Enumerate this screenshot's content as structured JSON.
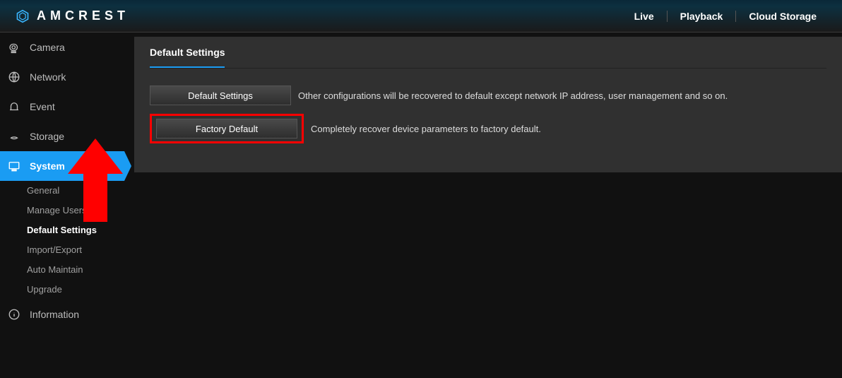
{
  "header": {
    "brand": "AMCREST",
    "nav": {
      "live": "Live",
      "playback": "Playback",
      "cloud": "Cloud Storage"
    }
  },
  "sidebar": {
    "camera": "Camera",
    "network": "Network",
    "event": "Event",
    "storage": "Storage",
    "system": "System",
    "system_sub": {
      "general": "General",
      "manage_users": "Manage Users",
      "default_settings": "Default Settings",
      "import_export": "Import/Export",
      "auto_maintain": "Auto Maintain",
      "upgrade": "Upgrade"
    },
    "information": "Information"
  },
  "panel": {
    "title": "Default Settings",
    "btn_default": "Default Settings",
    "desc_default": "Other configurations will be recovered to default except network IP address, user management and so on.",
    "btn_factory": "Factory Default",
    "desc_factory": "Completely recover device parameters to factory default."
  }
}
